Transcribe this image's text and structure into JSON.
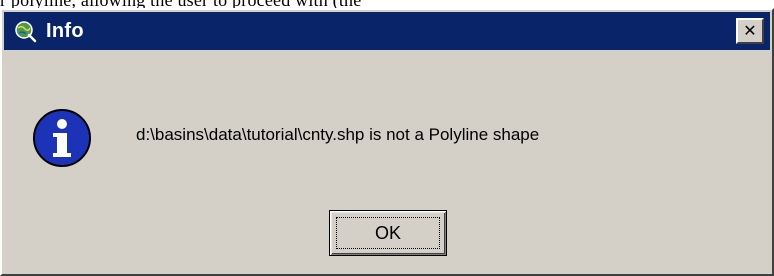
{
  "header_fragment": {
    "text": "r polyline, allowing the user to proceed with (the"
  },
  "dialog": {
    "title": "Info",
    "close_glyph": "✕",
    "message": "d:\\basins\\data\\tutorial\\cnty.shp is not a Polyline shape",
    "ok_label": "OK",
    "icons": {
      "app": "arcview-globe-icon",
      "message": "information-icon",
      "close": "close-icon"
    },
    "colors": {
      "titlebar": "#0a246a",
      "face": "#d4d0c8",
      "info_blue": "#1c33b8"
    }
  }
}
